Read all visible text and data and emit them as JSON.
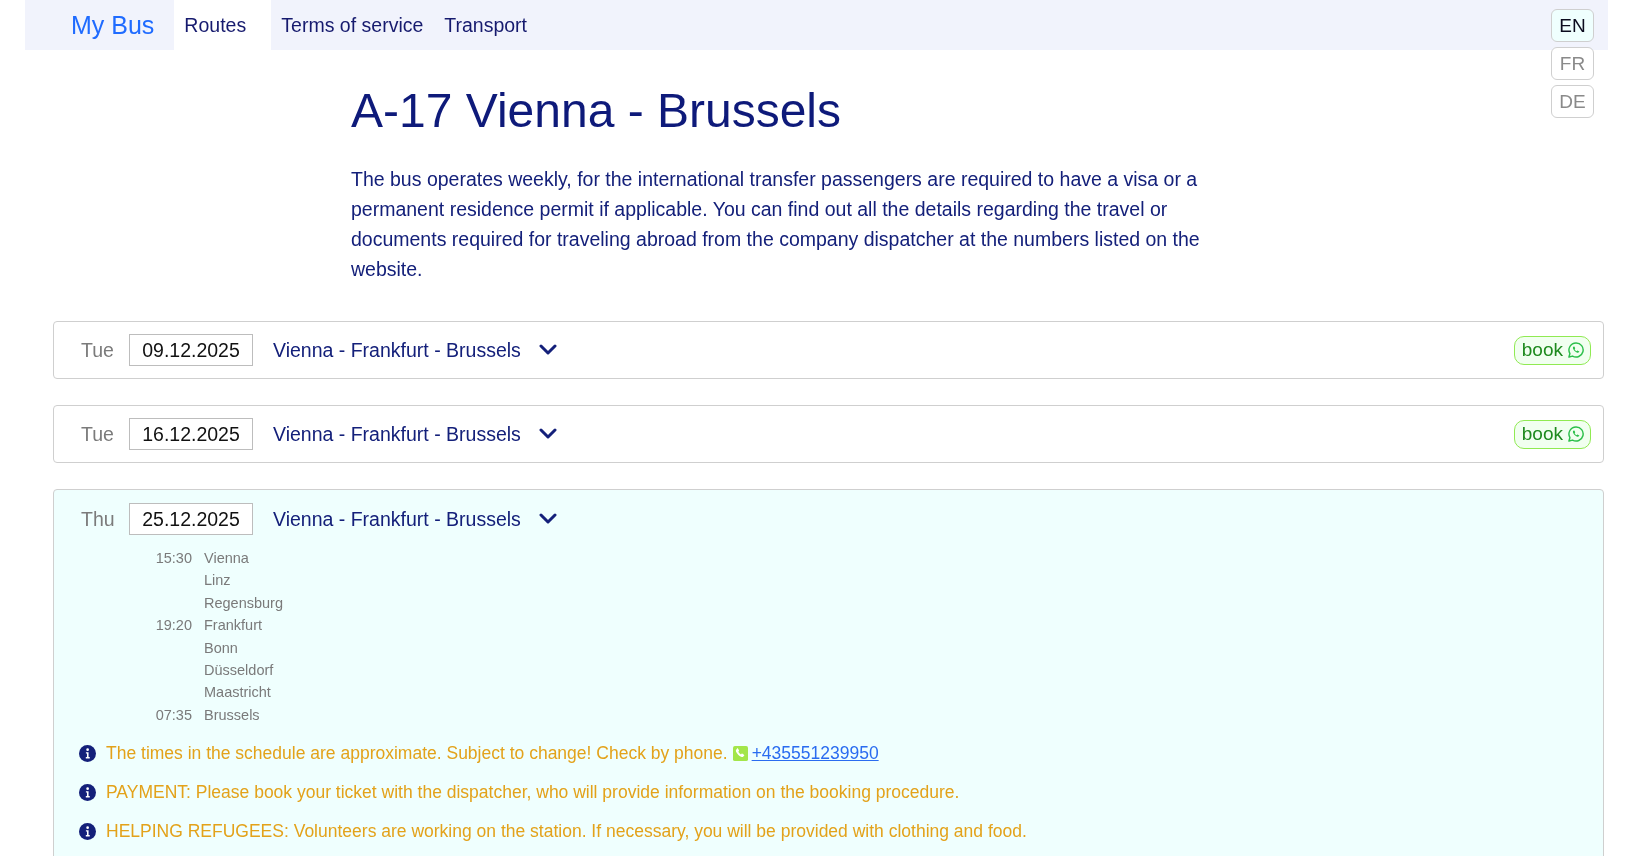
{
  "nav": {
    "brand": "My Bus",
    "items": [
      {
        "label": "Routes",
        "selected": true
      },
      {
        "label": "Terms of service",
        "selected": false
      },
      {
        "label": "Transport",
        "selected": false
      }
    ]
  },
  "languages": [
    {
      "label": "EN",
      "selected": true
    },
    {
      "label": "FR",
      "selected": false
    },
    {
      "label": "DE",
      "selected": false
    }
  ],
  "title": "A-17 Vienna - Brussels",
  "description": "The bus operates weekly, for the international transfer passengers are required to have a visa or a permanent residence permit if applicable. You can find out all the details regarding the travel or documents required for traveling abroad from the company dispatcher at the numbers listed on the website.",
  "trips": [
    {
      "day": "Tue",
      "date": "09.12.2025",
      "route": "Vienna - Frankfurt - Brussels",
      "expanded": false,
      "book": "book"
    },
    {
      "day": "Tue",
      "date": "16.12.2025",
      "route": "Vienna - Frankfurt - Brussels",
      "expanded": false,
      "book": "book"
    },
    {
      "day": "Thu",
      "date": "25.12.2025",
      "route": "Vienna - Frankfurt - Brussels",
      "expanded": true,
      "stops": [
        {
          "time": "15:30",
          "station": "Vienna"
        },
        {
          "station": "Linz"
        },
        {
          "station": "Regensburg"
        },
        {
          "time": "19:20",
          "station": "Frankfurt"
        },
        {
          "station": "Bonn"
        },
        {
          "station": "Düsseldorf"
        },
        {
          "station": "Maastricht"
        },
        {
          "time": "07:35",
          "station": "Brussels"
        }
      ],
      "notes": [
        {
          "text": "The times in the schedule are approximate. Subject to change! Check by phone.",
          "phone": "+435551239950"
        },
        {
          "text": "PAYMENT: Please book your ticket with the dispatcher, who will provide information on the booking procedure."
        },
        {
          "text": "HELPING REFUGEES: Volunteers are working on the station. If necessary, you will be provided with clothing and food."
        }
      ]
    }
  ]
}
